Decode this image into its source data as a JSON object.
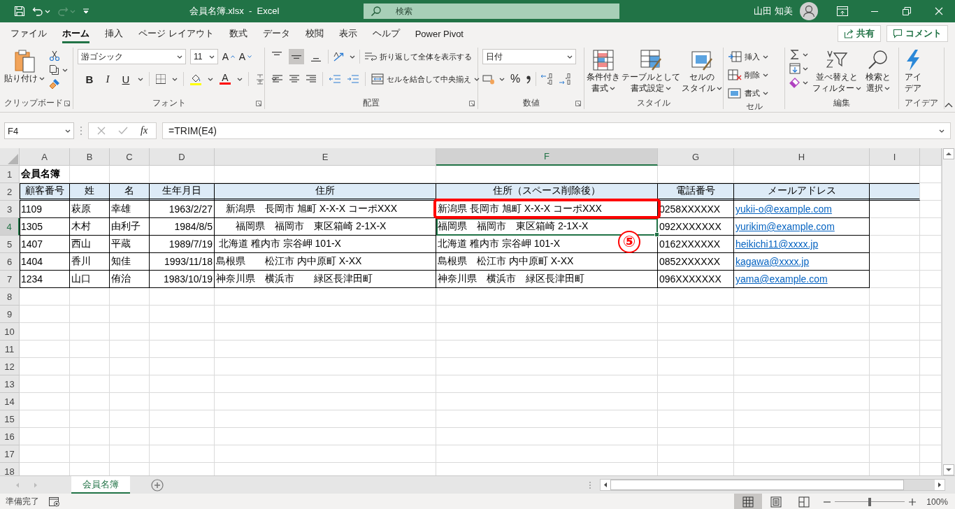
{
  "title_bar": {
    "redo_disabled": true,
    "title": "会員名簿.xlsx  -  Excel",
    "search_placeholder": "検索",
    "user_name": "山田 知美"
  },
  "menu_tabs": [
    {
      "label": "ファイル",
      "selected": false
    },
    {
      "label": "ホーム",
      "selected": true
    },
    {
      "label": "挿入",
      "selected": false
    },
    {
      "label": "ページ レイアウト",
      "selected": false
    },
    {
      "label": "数式",
      "selected": false
    },
    {
      "label": "データ",
      "selected": false
    },
    {
      "label": "校閲",
      "selected": false
    },
    {
      "label": "表示",
      "selected": false
    },
    {
      "label": "ヘルプ",
      "selected": false
    },
    {
      "label": "Power Pivot",
      "selected": false
    }
  ],
  "share_button": "共有",
  "comment_button": "コメント",
  "ribbon": {
    "clipboard": {
      "label": "クリップボード",
      "paste": "貼り付け"
    },
    "font": {
      "label": "フォント",
      "font_name": "游ゴシック",
      "font_size": "11",
      "grow": "A",
      "shrink": "A",
      "bold": "B",
      "italic": "I",
      "underline": "U",
      "font_color": "A"
    },
    "alignment": {
      "label": "配置",
      "vertical": [
        {
          "selected": false
        },
        {
          "selected": true
        },
        {
          "selected": false
        }
      ],
      "wrap": "折り返して全体を表示する",
      "merge": "セルを結合して中央揃え"
    },
    "number": {
      "label": "数値",
      "format": "日付",
      "percent": "%"
    },
    "styles": {
      "label": "スタイル",
      "buttons": [
        {
          "lines": [
            "条件付き",
            "書式"
          ]
        },
        {
          "lines": [
            "テーブルとして",
            "書式設定"
          ]
        },
        {
          "lines": [
            "セルの",
            "スタイル"
          ]
        }
      ]
    },
    "cells": {
      "label": "セル",
      "buttons": [
        "挿入",
        "削除",
        "書式"
      ]
    },
    "editing": {
      "label": "編集",
      "buttons": [
        {
          "lines": [
            "並べ替えと",
            "フィルター"
          ]
        },
        {
          "lines": [
            "検索と",
            "選択"
          ]
        }
      ]
    },
    "ideas": {
      "label": "アイデア",
      "lines": [
        "アイ",
        "デア"
      ]
    }
  },
  "formula_bar": {
    "name_box": "F4",
    "function_button": "fx",
    "formula": "=TRIM(E4)"
  },
  "columns": [
    {
      "letter": "A",
      "kind": "text",
      "selected": false
    },
    {
      "letter": "B",
      "kind": "text",
      "selected": false
    },
    {
      "letter": "C",
      "kind": "text",
      "selected": false
    },
    {
      "letter": "D",
      "kind": "number",
      "selected": false
    },
    {
      "letter": "E",
      "kind": "text",
      "selected": false
    },
    {
      "letter": "F",
      "kind": "text",
      "selected": true
    },
    {
      "letter": "G",
      "kind": "text",
      "selected": false
    },
    {
      "letter": "H",
      "kind": "link",
      "selected": false
    },
    {
      "letter": "I",
      "kind": "text",
      "selected": false
    }
  ],
  "rows": [
    {
      "number": "1",
      "kind": "title",
      "selected": false,
      "cells": [
        {
          "text": "会員名簿",
          "selected": false
        }
      ]
    },
    {
      "number": "2",
      "kind": "header",
      "selected": false,
      "cells": [
        {
          "text": "顧客番号",
          "selected": false
        },
        {
          "text": "姓",
          "selected": false
        },
        {
          "text": "名",
          "selected": false
        },
        {
          "text": "生年月日",
          "selected": false
        },
        {
          "text": "住所",
          "selected": false
        },
        {
          "text": "住所（スペース削除後）",
          "selected": false
        },
        {
          "text": "電話番号",
          "selected": false
        },
        {
          "text": "メールアドレス",
          "selected": false
        }
      ]
    },
    {
      "number": "3",
      "kind": "data",
      "selected": false,
      "cells": [
        {
          "text": "1109",
          "selected": false
        },
        {
          "text": "萩原",
          "selected": false
        },
        {
          "text": "幸雄",
          "selected": false
        },
        {
          "text": "1963/2/27",
          "selected": false
        },
        {
          "text": "　新潟県　長岡市 旭町 X-X-X コーポXXX",
          "selected": false
        },
        {
          "text": "新潟県 長岡市 旭町 X-X-X コーポXXX",
          "selected": false
        },
        {
          "text": "0258XXXXXX",
          "selected": false
        },
        {
          "text": "yukii-o@example.com",
          "selected": false
        }
      ]
    },
    {
      "number": "4",
      "kind": "data",
      "selected": true,
      "cells": [
        {
          "text": "1305",
          "selected": false
        },
        {
          "text": "木村",
          "selected": false
        },
        {
          "text": "由利子",
          "selected": false
        },
        {
          "text": "1984/8/5",
          "selected": false
        },
        {
          "text": "　　福岡県　福岡市　東区箱崎 2-1X-X",
          "selected": false
        },
        {
          "text": "福岡県　福岡市　東区箱崎 2-1X-X",
          "selected": true
        },
        {
          "text": "092XXXXXXX",
          "selected": false
        },
        {
          "text": "yurikim@example.com",
          "selected": false
        }
      ]
    },
    {
      "number": "5",
      "kind": "data",
      "selected": false,
      "cells": [
        {
          "text": "1407",
          "selected": false
        },
        {
          "text": "西山",
          "selected": false
        },
        {
          "text": "平蔵",
          "selected": false
        },
        {
          "text": "1989/7/19",
          "selected": false
        },
        {
          "text": " 北海道 稚内市 宗谷岬 101-X",
          "selected": false
        },
        {
          "text": "北海道 稚内市 宗谷岬 101-X",
          "selected": false
        },
        {
          "text": "0162XXXXXX",
          "selected": false
        },
        {
          "text": "heikichi11@xxxx.jp",
          "selected": false
        }
      ]
    },
    {
      "number": "6",
      "kind": "data",
      "selected": false,
      "cells": [
        {
          "text": "1404",
          "selected": false
        },
        {
          "text": "香川",
          "selected": false
        },
        {
          "text": "知佳",
          "selected": false
        },
        {
          "text": "1993/11/18",
          "selected": false
        },
        {
          "text": "島根県　　松江市 内中原町 X-XX",
          "selected": false
        },
        {
          "text": "島根県　松江市 内中原町 X-XX",
          "selected": false
        },
        {
          "text": "0852XXXXXX",
          "selected": false
        },
        {
          "text": "kagawa@xxxx.jp",
          "selected": false
        }
      ]
    },
    {
      "number": "7",
      "kind": "data",
      "selected": false,
      "cells": [
        {
          "text": "1234",
          "selected": false
        },
        {
          "text": "山口",
          "selected": false
        },
        {
          "text": "侑治",
          "selected": false
        },
        {
          "text": "1983/10/19",
          "selected": false
        },
        {
          "text": "神奈川県　横浜市　　緑区長津田町",
          "selected": false
        },
        {
          "text": "神奈川県　横浜市　緑区長津田町",
          "selected": false
        },
        {
          "text": "096XXXXXXX",
          "selected": false
        },
        {
          "text": "yama@example.com",
          "selected": false
        }
      ]
    },
    {
      "number": "8",
      "kind": "empty",
      "selected": false
    },
    {
      "number": "9",
      "kind": "empty",
      "selected": false
    },
    {
      "number": "10",
      "kind": "empty",
      "selected": false
    },
    {
      "number": "11",
      "kind": "empty",
      "selected": false
    },
    {
      "number": "12",
      "kind": "empty",
      "selected": false
    },
    {
      "number": "13",
      "kind": "empty",
      "selected": false
    },
    {
      "number": "14",
      "kind": "empty",
      "selected": false
    },
    {
      "number": "15",
      "kind": "empty",
      "selected": false
    },
    {
      "number": "16",
      "kind": "empty",
      "selected": false
    },
    {
      "number": "17",
      "kind": "empty",
      "selected": false
    },
    {
      "number": "18",
      "kind": "empty",
      "selected": false
    }
  ],
  "callout": {
    "label": "⑤"
  },
  "sheet_tabs": [
    {
      "label": "会員名簿",
      "selected": true
    }
  ],
  "status_bar": {
    "status": "準備完了",
    "views": [
      {
        "selected": true
      },
      {
        "selected": false
      },
      {
        "selected": false
      }
    ],
    "level": 0.5,
    "zoom": "100%"
  }
}
